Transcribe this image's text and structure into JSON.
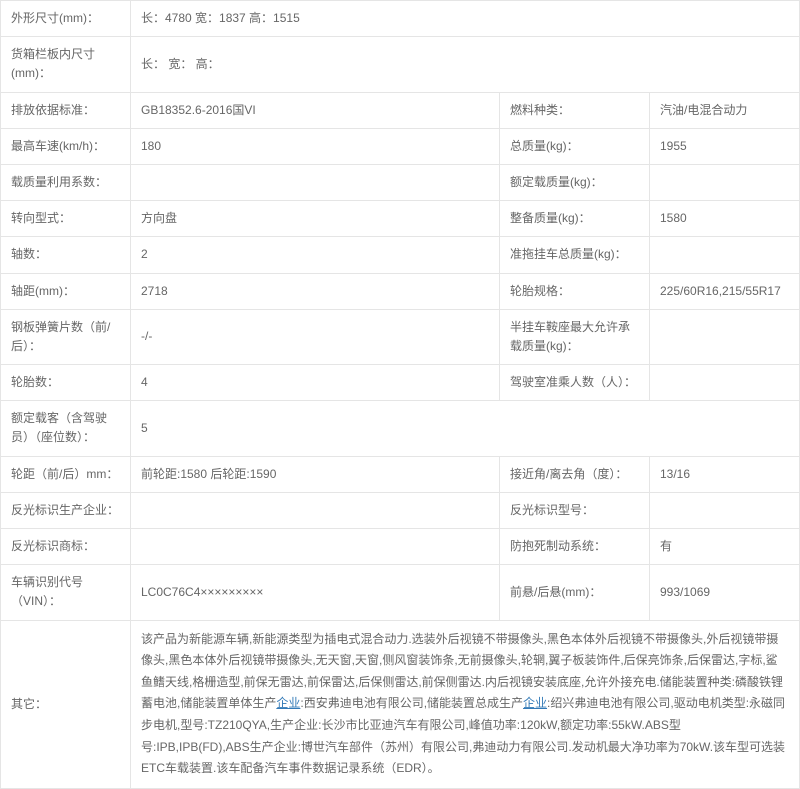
{
  "rows": [
    {
      "cells": [
        {
          "cls": "label",
          "span": 1,
          "text": "外形尺寸(mm)："
        },
        {
          "cls": "val",
          "span": 3,
          "text": "长：4780 宽：1837 高：1515"
        }
      ]
    },
    {
      "cells": [
        {
          "cls": "label",
          "span": 1,
          "text": "货箱栏板内尺寸(mm)："
        },
        {
          "cls": "val",
          "span": 3,
          "text": "长： 宽： 高："
        }
      ]
    },
    {
      "cells": [
        {
          "cls": "label",
          "span": 1,
          "text": "排放依据标准："
        },
        {
          "cls": "val",
          "span": 1,
          "text": "GB18352.6-2016国VI"
        },
        {
          "cls": "label",
          "span": 1,
          "text": "燃料种类："
        },
        {
          "cls": "val",
          "span": 1,
          "text": "汽油/电混合动力"
        }
      ]
    },
    {
      "cells": [
        {
          "cls": "label",
          "span": 1,
          "text": "最高车速(km/h)："
        },
        {
          "cls": "val",
          "span": 1,
          "text": "180"
        },
        {
          "cls": "label",
          "span": 1,
          "text": "总质量(kg)："
        },
        {
          "cls": "val",
          "span": 1,
          "text": "1955"
        }
      ]
    },
    {
      "cells": [
        {
          "cls": "label",
          "span": 1,
          "text": "载质量利用系数："
        },
        {
          "cls": "val",
          "span": 1,
          "text": ""
        },
        {
          "cls": "label",
          "span": 1,
          "text": "额定载质量(kg)："
        },
        {
          "cls": "val",
          "span": 1,
          "text": ""
        }
      ]
    },
    {
      "cells": [
        {
          "cls": "label",
          "span": 1,
          "text": "转向型式："
        },
        {
          "cls": "val",
          "span": 1,
          "text": "方向盘"
        },
        {
          "cls": "label",
          "span": 1,
          "text": "整备质量(kg)："
        },
        {
          "cls": "val",
          "span": 1,
          "text": "1580"
        }
      ]
    },
    {
      "cells": [
        {
          "cls": "label",
          "span": 1,
          "text": "轴数："
        },
        {
          "cls": "val",
          "span": 1,
          "text": "2"
        },
        {
          "cls": "label",
          "span": 1,
          "text": "准拖挂车总质量(kg)："
        },
        {
          "cls": "val",
          "span": 1,
          "text": ""
        }
      ]
    },
    {
      "cells": [
        {
          "cls": "label",
          "span": 1,
          "text": "轴距(mm)："
        },
        {
          "cls": "val",
          "span": 1,
          "text": "2718"
        },
        {
          "cls": "label",
          "span": 1,
          "text": "轮胎规格："
        },
        {
          "cls": "val",
          "span": 1,
          "text": "225/60R16,215/55R17"
        }
      ]
    },
    {
      "cells": [
        {
          "cls": "label",
          "span": 1,
          "text": "钢板弹簧片数（前/后）："
        },
        {
          "cls": "val",
          "span": 1,
          "text": "-/-"
        },
        {
          "cls": "label",
          "span": 1,
          "text": "半挂车鞍座最大允许承载质量(kg)："
        },
        {
          "cls": "val",
          "span": 1,
          "text": ""
        }
      ]
    },
    {
      "cells": [
        {
          "cls": "label",
          "span": 1,
          "text": "轮胎数："
        },
        {
          "cls": "val",
          "span": 1,
          "text": "4"
        },
        {
          "cls": "label",
          "span": 1,
          "text": "驾驶室准乘人数（人）："
        },
        {
          "cls": "val",
          "span": 1,
          "text": ""
        }
      ]
    },
    {
      "cells": [
        {
          "cls": "label",
          "span": 1,
          "text": "额定载客（含驾驶员）（座位数）："
        },
        {
          "cls": "val",
          "span": 3,
          "text": "5"
        }
      ]
    },
    {
      "cells": [
        {
          "cls": "label",
          "span": 1,
          "text": "轮距（前/后）mm："
        },
        {
          "cls": "val",
          "span": 1,
          "text": "前轮距:1580 后轮距:1590"
        },
        {
          "cls": "label",
          "span": 1,
          "text": "接近角/离去角（度）："
        },
        {
          "cls": "val",
          "span": 1,
          "text": "13/16"
        }
      ]
    },
    {
      "cells": [
        {
          "cls": "label",
          "span": 1,
          "text": "反光标识生产企业："
        },
        {
          "cls": "val",
          "span": 1,
          "text": ""
        },
        {
          "cls": "label",
          "span": 1,
          "text": "反光标识型号："
        },
        {
          "cls": "val",
          "span": 1,
          "text": ""
        }
      ]
    },
    {
      "cells": [
        {
          "cls": "label",
          "span": 1,
          "text": "反光标识商标："
        },
        {
          "cls": "val",
          "span": 1,
          "text": ""
        },
        {
          "cls": "label",
          "span": 1,
          "text": "防抱死制动系统："
        },
        {
          "cls": "val",
          "span": 1,
          "text": "有"
        }
      ]
    },
    {
      "cells": [
        {
          "cls": "label",
          "span": 1,
          "text": "车辆识别代号（VIN）："
        },
        {
          "cls": "val",
          "span": 1,
          "text": "LC0C76C4×××××××××"
        },
        {
          "cls": "label",
          "span": 1,
          "text": "前悬/后悬(mm)："
        },
        {
          "cls": "val",
          "span": 1,
          "text": "993/1069"
        }
      ]
    }
  ],
  "other": {
    "label": "其它：",
    "parts": [
      "该产品为新能源车辆,新能源类型为插电式混合动力.选装外后视镜不带摄像头,黑色本体外后视镜不带摄像头,外后视镜带摄像头,黑色本体外后视镜带摄像头,无天窗,天窗,侧风窗装饰条,无前摄像头,轮辋,翼子板装饰件,后保亮饰条,后保雷达,字标,鲨鱼鳍天线,格栅造型,前保无雷达,前保雷达,后保侧雷达,前保侧雷达.内后视镜安装底座,允许外接充电.储能装置种类:磷酸铁锂蓄电池,储能装置单体生产",
      "企业",
      ":西安弗迪电池有限公司,储能装置总成生产",
      "企业",
      ":绍兴弗迪电池有限公司,驱动电机类型:永磁同步电机,型号:TZ210QYA,生产企业:长沙市比亚迪汽车有限公司,峰值功率:120kW,额定功率:55kW.ABS型号:IPB,IPB(FD),ABS生产企业:博世汽车部件（苏州）有限公司,弗迪动力有限公司.发动机最大净功率为70kW.该车型可选装ETC车载装置.该车配备汽车事件数据记录系统（EDR）。"
    ],
    "link_indices": [
      1,
      3
    ]
  }
}
